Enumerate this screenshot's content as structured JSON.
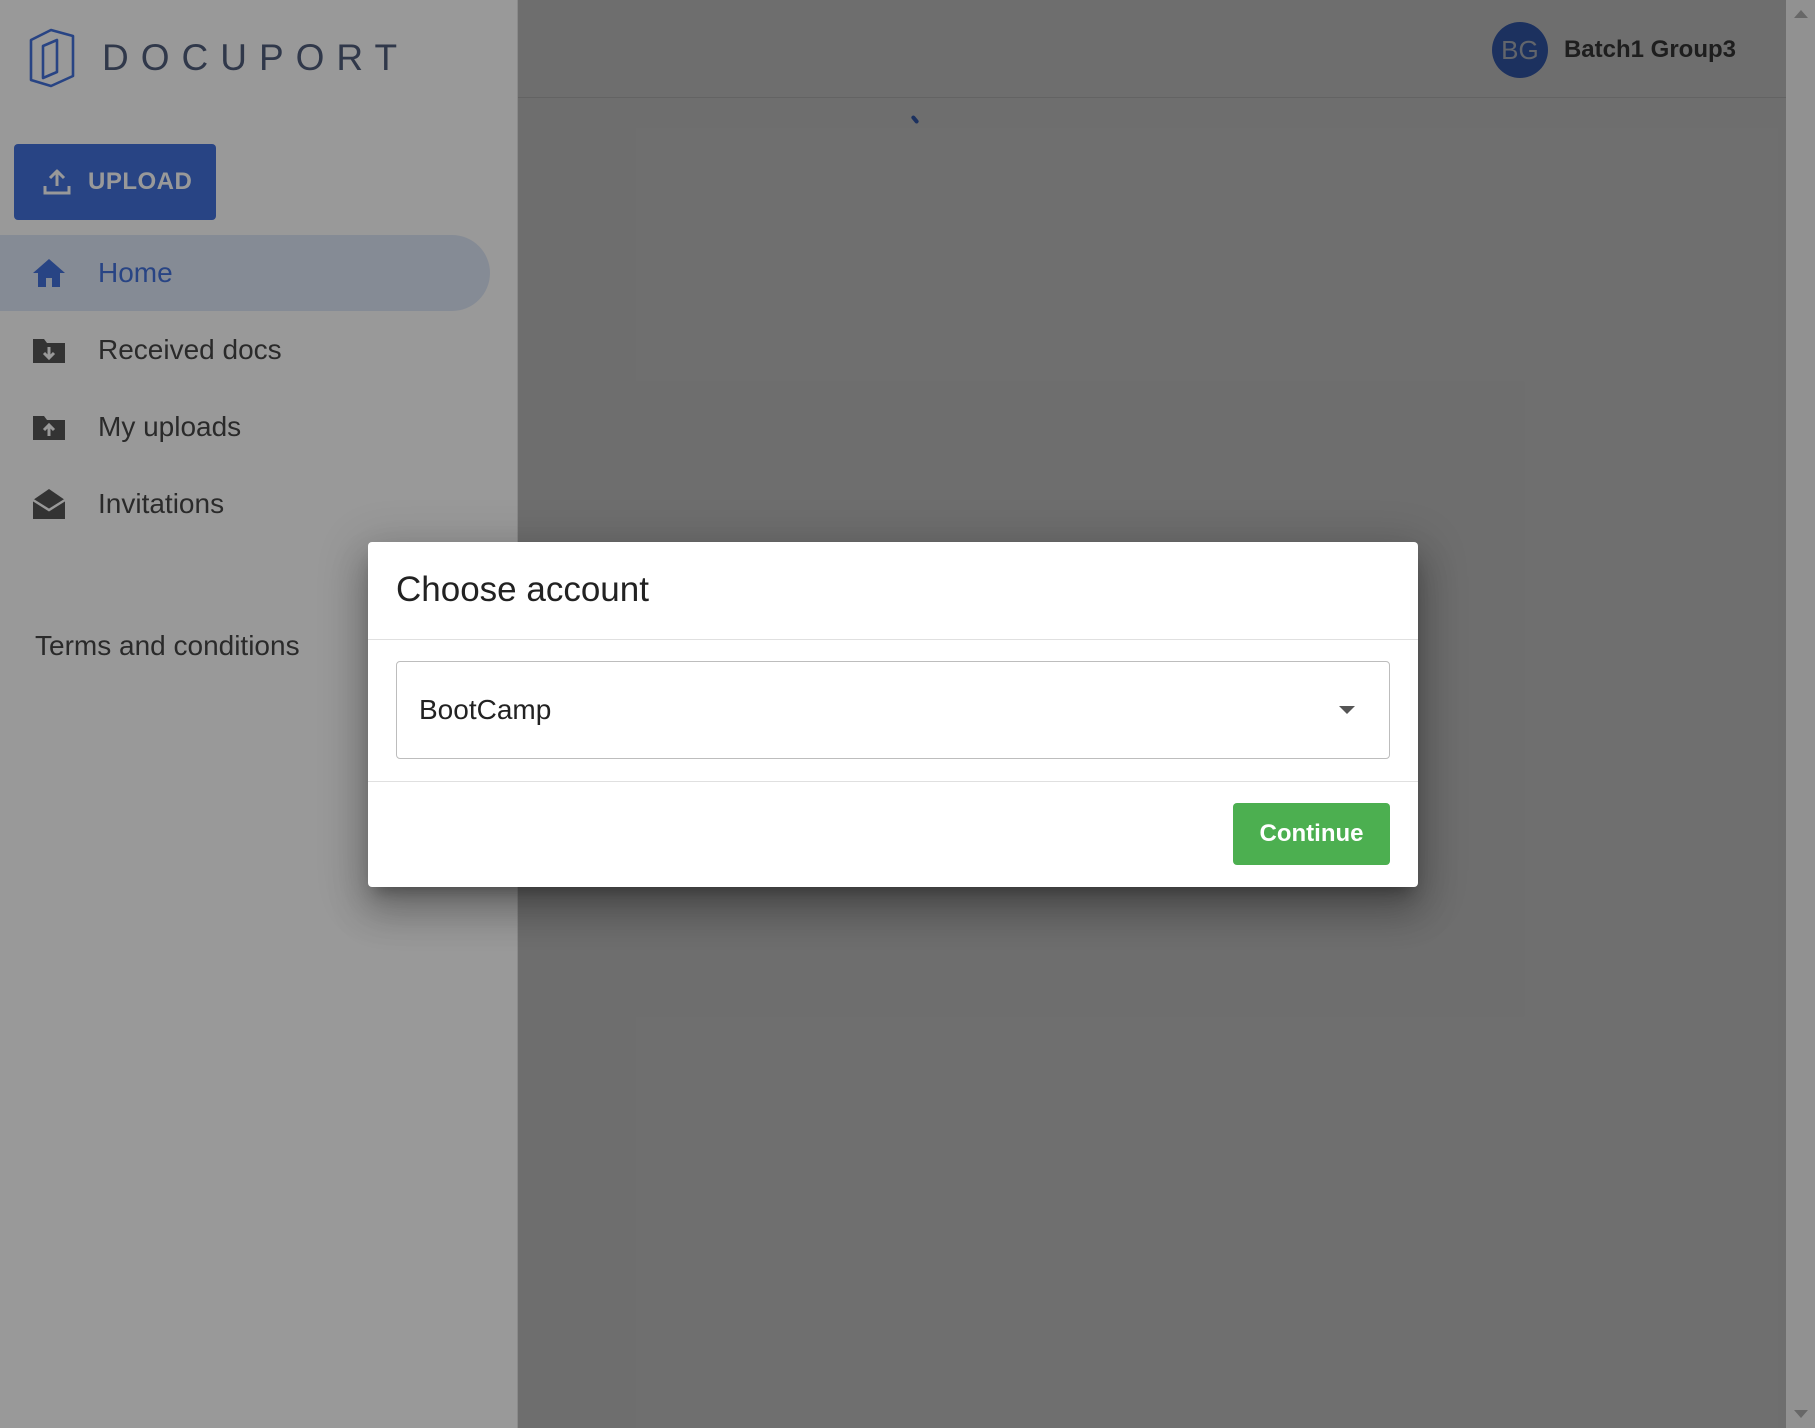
{
  "app": {
    "logo_text": "DOCUPORT"
  },
  "sidebar": {
    "upload_label": "UPLOAD",
    "items": [
      {
        "label": "Home",
        "icon": "home-icon",
        "active": true
      },
      {
        "label": "Received docs",
        "icon": "folder-download-icon",
        "active": false
      },
      {
        "label": "My uploads",
        "icon": "folder-upload-icon",
        "active": false
      },
      {
        "label": "Invitations",
        "icon": "envelope-open-icon",
        "active": false
      }
    ],
    "terms_label": "Terms and conditions"
  },
  "header": {
    "user": {
      "initials": "BG",
      "name": "Batch1 Group3"
    }
  },
  "dialog": {
    "title": "Choose account",
    "select": {
      "value": "BootCamp"
    },
    "continue_label": "Continue"
  },
  "colors": {
    "primary": "#2f63d9",
    "success": "#4caf50",
    "active_bg": "#dbe5f7"
  }
}
